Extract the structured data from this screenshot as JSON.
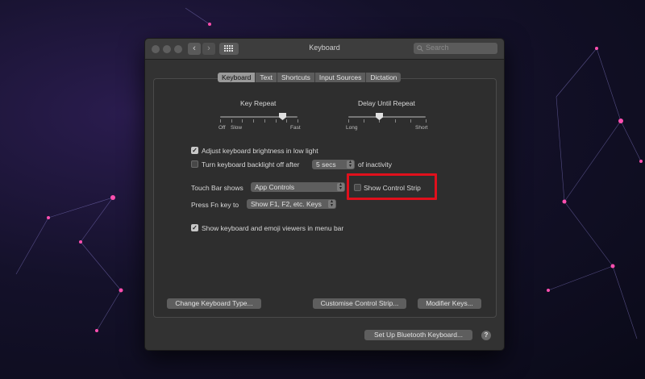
{
  "window": {
    "title": "Keyboard",
    "search_placeholder": "Search"
  },
  "tabs": [
    "Keyboard",
    "Text",
    "Shortcuts",
    "Input Sources",
    "Dictation"
  ],
  "key_repeat": {
    "label": "Key Repeat",
    "tick_labels": [
      "Off",
      "Slow",
      "Fast"
    ],
    "value_fraction": 0.8
  },
  "delay_until_repeat": {
    "label": "Delay Until Repeat",
    "tick_labels": [
      "Long",
      "Short"
    ],
    "value_fraction": 0.4
  },
  "options": {
    "adjust_brightness": {
      "label": "Adjust keyboard brightness in low light",
      "checked": true
    },
    "backlight_off": {
      "label": "Turn keyboard backlight off after",
      "checked": false,
      "value": "5 secs",
      "suffix": "of inactivity"
    },
    "touch_bar": {
      "label": "Touch Bar shows",
      "value": "App Controls"
    },
    "control_strip": {
      "label": "Show Control Strip",
      "checked": false
    },
    "fn_key": {
      "label": "Press Fn key to",
      "value": "Show F1, F2, etc. Keys"
    },
    "viewers_menu_bar": {
      "label": "Show keyboard and emoji viewers in menu bar",
      "checked": true
    }
  },
  "buttons": {
    "change_type": "Change Keyboard Type...",
    "customise_strip": "Customise Control Strip...",
    "modifier_keys": "Modifier Keys...",
    "bluetooth": "Set Up Bluetooth Keyboard...",
    "help": "?"
  },
  "colors": {
    "highlight": "#e0101c",
    "window_bg": "#323232"
  }
}
